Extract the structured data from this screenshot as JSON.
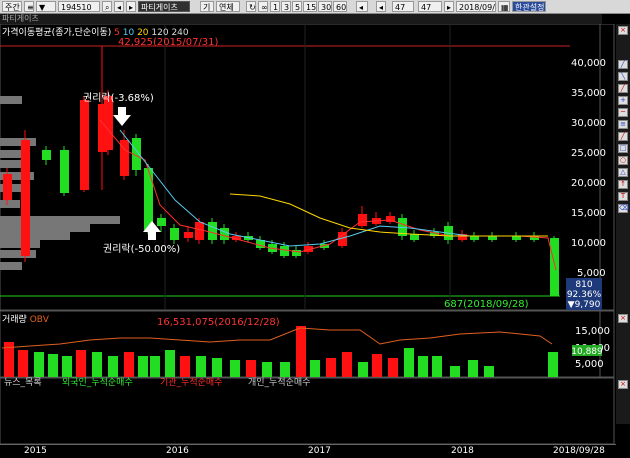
{
  "toolbar": {
    "items": [
      "주간",
      "194510",
      "파티게이츠",
      "기",
      "연체",
      "1",
      "3",
      "5",
      "15",
      "30",
      "60",
      "47",
      "47",
      "2018/09/28",
      "한관설정"
    ]
  },
  "window_title": "파티게이츠",
  "price_pane": {
    "title": "가격이동평균(종가,단순이동)",
    "periods": [
      "5",
      "10",
      "20",
      "120",
      "240"
    ],
    "high_label": "42,925(2015/07/31)",
    "low_label": "687(2018/09/28)",
    "annotation_rights1": "권리락(-3.68%)",
    "annotation_rights2": "권리락(-50.00%)",
    "y_ticks": [
      "40,000",
      "35,000",
      "30,000",
      "25,000",
      "20,000",
      "15,000",
      "10,000",
      "5,000"
    ],
    "current_price": "810",
    "current_pct": "92.36%",
    "current_change": "▼9,790"
  },
  "volume_pane": {
    "title": "거래량",
    "obv_label": "OBV",
    "high_label": "16,531,075(2016/12/28)",
    "y_ticks": [
      "15,000",
      "10,000",
      "5,000"
    ],
    "current_volume": "10,889",
    "unit": "0,000"
  },
  "tabs": [
    "뉴스_목록",
    "외국인_누적순매수",
    "기관_누적순매수",
    "개인_누적순매수"
  ],
  "x_axis": [
    "2015",
    "2016",
    "2017",
    "2018",
    "2018/09/28"
  ],
  "colors": {
    "up": "#ff1111",
    "down": "#22dd22",
    "ma5": "#ff3030",
    "ma10": "#55ccee",
    "ma20": "#ffd700",
    "obv": "#e06020"
  }
}
